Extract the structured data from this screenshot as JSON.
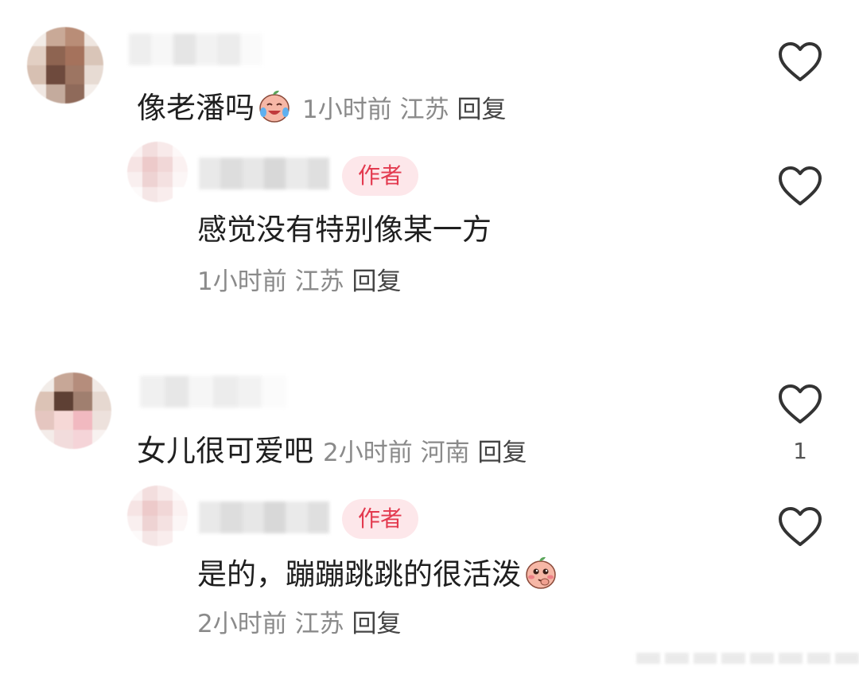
{
  "comments": [
    {
      "text": "像老潘吗",
      "time": "1小时前",
      "location": "江苏",
      "reply_label": "回复",
      "emoji_icon": "crying-laughing-peach-emoji",
      "reply": {
        "badge": "作者",
        "text": "感觉没有特别像某一方",
        "time": "1小时前",
        "location": "江苏",
        "reply_label": "回复"
      }
    },
    {
      "text": "女儿很可爱吧",
      "time": "2小时前",
      "location": "河南",
      "reply_label": "回复",
      "like_count": "1",
      "reply": {
        "badge": "作者",
        "text": "是的，蹦蹦跳跳的很活泼",
        "time": "2小时前",
        "location": "江苏",
        "reply_label": "回复",
        "emoji_icon": "shy-peach-emoji"
      }
    }
  ],
  "colors": {
    "badge_bg": "#fde7ea",
    "badge_text": "#e33a4f",
    "meta_gray": "#8a8a8a",
    "heart_stroke": "#333333"
  }
}
